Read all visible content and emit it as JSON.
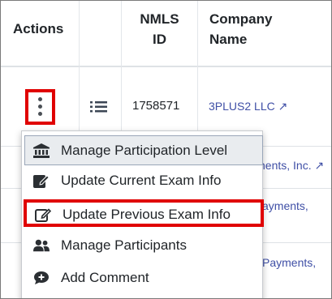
{
  "table": {
    "headers": {
      "actions": "Actions",
      "nmls_line1": "NMLS",
      "nmls_line2": "ID",
      "company_line1": "Company",
      "company_line2": "Name"
    },
    "rows": [
      {
        "nmls_id": "1758571",
        "company": "3PLUS2 LLC ↗"
      }
    ],
    "truncated_links": [
      "nents, Inc. ↗",
      "ayments,",
      "",
      "Payments,",
      ""
    ]
  },
  "menu": {
    "items": [
      {
        "label": "Manage Participation Level",
        "icon": "bank-icon"
      },
      {
        "label": "Update Current Exam Info",
        "icon": "edit-icon"
      },
      {
        "label": "Update Previous Exam Info",
        "icon": "edit-outline-icon"
      },
      {
        "label": "Manage Participants",
        "icon": "users-icon"
      },
      {
        "label": "Add Comment",
        "icon": "comment-plus-icon"
      }
    ]
  },
  "colors": {
    "highlight_border": "#e00000",
    "link": "#3f4fa6",
    "hover_bg": "#e9ecef"
  }
}
